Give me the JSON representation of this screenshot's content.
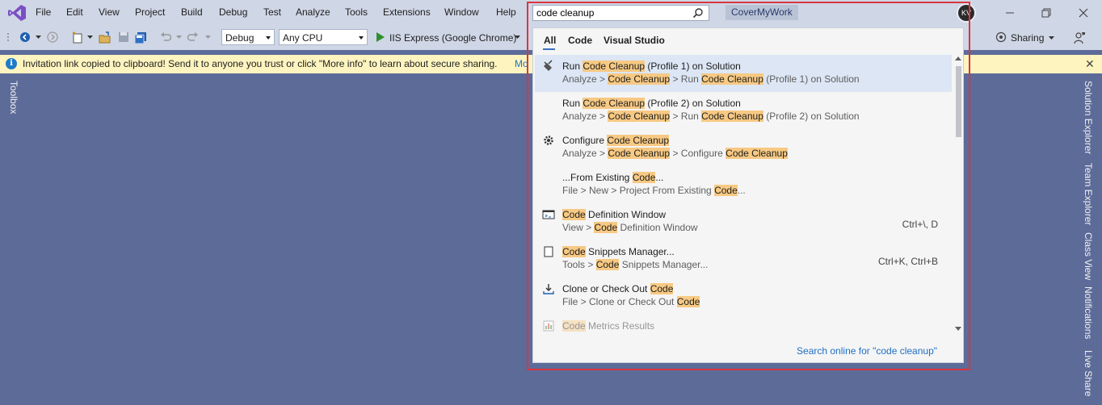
{
  "menu": {
    "items": [
      "File",
      "Edit",
      "View",
      "Project",
      "Build",
      "Debug",
      "Test",
      "Analyze",
      "Tools",
      "Extensions",
      "Window",
      "Help"
    ],
    "solution_name": "CoverMyWork",
    "avatar_initials": "KV"
  },
  "toolbar": {
    "configuration": "Debug",
    "platform": "Any CPU",
    "run_target": "IIS Express (Google Chrome)",
    "sharing_label": "Sharing"
  },
  "infobar": {
    "message": "Invitation link copied to clipboard! Send it to anyone you trust or click \"More info\" to learn about secure sharing.",
    "link": "Mo"
  },
  "side_tabs": {
    "left": "Toolbox",
    "right": [
      "Solution Explorer",
      "Team Explorer",
      "Class View",
      "Notifications",
      "Live Share"
    ]
  },
  "search": {
    "query": "code cleanup",
    "tabs": [
      "All",
      "Code",
      "Visual Studio"
    ],
    "active_tab": "All",
    "results": [
      {
        "icon": "broom-icon",
        "title": [
          [
            "Run ",
            false
          ],
          [
            "Code Cleanup",
            true
          ],
          [
            " (Profile 1) on Solution",
            false
          ]
        ],
        "path": [
          [
            "Analyze > ",
            false
          ],
          [
            "Code Cleanup",
            true
          ],
          [
            " > Run ",
            false
          ],
          [
            "Code Cleanup",
            true
          ],
          [
            " (Profile 1) on Solution",
            false
          ]
        ],
        "shortcut": "",
        "selected": true
      },
      {
        "icon": "",
        "title": [
          [
            "Run ",
            false
          ],
          [
            "Code Cleanup",
            true
          ],
          [
            " (Profile 2) on Solution",
            false
          ]
        ],
        "path": [
          [
            "Analyze > ",
            false
          ],
          [
            "Code Cleanup",
            true
          ],
          [
            " > Run ",
            false
          ],
          [
            "Code Cleanup",
            true
          ],
          [
            " (Profile 2) on Solution",
            false
          ]
        ],
        "shortcut": ""
      },
      {
        "icon": "gear-icon",
        "title": [
          [
            "Configure ",
            false
          ],
          [
            "Code Cleanup",
            true
          ]
        ],
        "path": [
          [
            "Analyze > ",
            false
          ],
          [
            "Code Cleanup",
            true
          ],
          [
            " > Configure ",
            false
          ],
          [
            "Code Cleanup",
            true
          ]
        ],
        "shortcut": ""
      },
      {
        "icon": "",
        "title": [
          [
            "...From Existing ",
            false
          ],
          [
            "Code",
            true
          ],
          [
            "...",
            false
          ]
        ],
        "path": [
          [
            "File > New > Project From Existing ",
            false
          ],
          [
            "Code",
            true
          ],
          [
            "...",
            false
          ]
        ],
        "shortcut": ""
      },
      {
        "icon": "code-window-icon",
        "title": [
          [
            "Code",
            true
          ],
          [
            " Definition Window",
            false
          ]
        ],
        "path": [
          [
            "View > ",
            false
          ],
          [
            "Code",
            true
          ],
          [
            " Definition Window",
            false
          ]
        ],
        "shortcut": "Ctrl+\\, D"
      },
      {
        "icon": "snippet-icon",
        "title": [
          [
            "Code",
            true
          ],
          [
            " Snippets Manager...",
            false
          ]
        ],
        "path": [
          [
            "Tools > ",
            false
          ],
          [
            "Code",
            true
          ],
          [
            " Snippets Manager...",
            false
          ]
        ],
        "shortcut": "Ctrl+K, Ctrl+B"
      },
      {
        "icon": "clone-icon",
        "title": [
          [
            "Clone or Check Out ",
            false
          ],
          [
            "Code",
            true
          ]
        ],
        "path": [
          [
            "File > Clone or Check Out ",
            false
          ],
          [
            "Code",
            true
          ]
        ],
        "shortcut": ""
      },
      {
        "icon": "metrics-icon",
        "title": [
          [
            "Code",
            true
          ],
          [
            " Metrics Results",
            false
          ]
        ],
        "path": [],
        "shortcut": "",
        "faded": true
      }
    ],
    "search_online": "Search online for \"code cleanup\""
  },
  "colors": {
    "chrome": "#cfd6e5",
    "workspace": "#5d6b99",
    "highlight": "#f7c983",
    "accent_link": "#1f6fc5",
    "annotation_border": "#d9363e"
  }
}
